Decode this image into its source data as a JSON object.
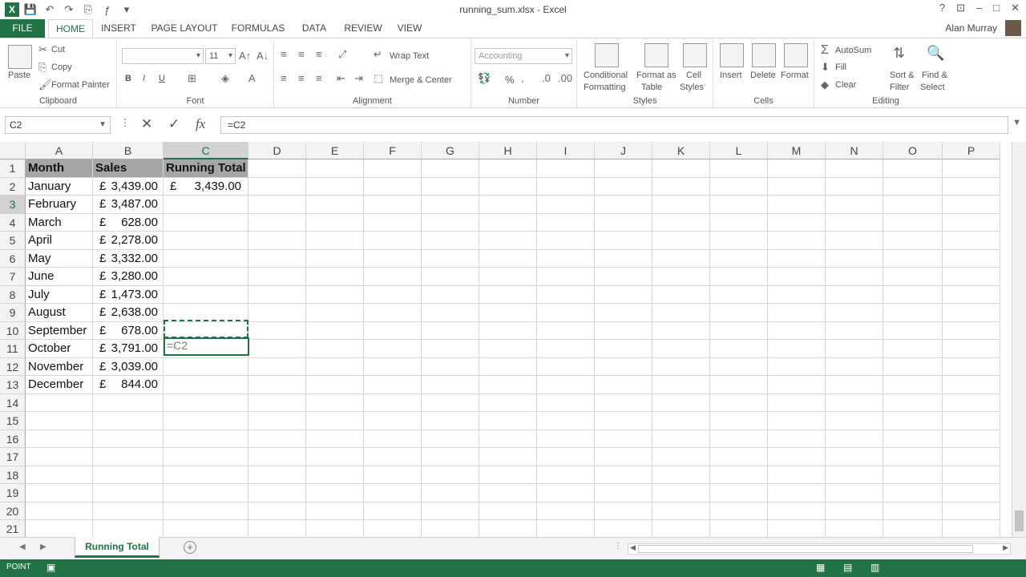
{
  "window": {
    "title": "running_sum.xlsx - Excel",
    "controls": [
      "?",
      "⊡",
      "–",
      "□",
      "✕"
    ]
  },
  "tabs": [
    {
      "label": "FILE"
    },
    {
      "label": "HOME"
    },
    {
      "label": "INSERT"
    },
    {
      "label": "PAGE LAYOUT"
    },
    {
      "label": "FORMULAS"
    },
    {
      "label": "DATA"
    },
    {
      "label": "REVIEW"
    },
    {
      "label": "VIEW"
    }
  ],
  "user": "Alan Murray",
  "ribbon": {
    "clipboard": {
      "label": "Clipboard",
      "paste": "Paste",
      "cut": "Cut",
      "copy": "Copy",
      "format_painter": "Format Painter"
    },
    "font": {
      "label": "Font",
      "size": "11",
      "bold": "B",
      "italic": "I",
      "underline": "U"
    },
    "alignment": {
      "label": "Alignment",
      "wrap": "Wrap Text",
      "merge": "Merge & Center"
    },
    "number": {
      "label": "Number",
      "format": "Accounting",
      "percent": "%"
    },
    "styles": {
      "label": "Styles",
      "conditional": "Conditional",
      "conditional2": "Formatting",
      "format_as": "Format as",
      "format_as2": "Table",
      "cell": "Cell",
      "cell2": "Styles"
    },
    "cells": {
      "label": "Cells",
      "insert": "Insert",
      "delete": "Delete",
      "format": "Format"
    },
    "editing": {
      "label": "Editing",
      "autosum": "AutoSum",
      "fill": "Fill",
      "clear": "Clear",
      "sort": "Sort &",
      "sort2": "Filter",
      "find": "Find &",
      "find2": "Select"
    }
  },
  "formula_bar": {
    "name_box": "C2",
    "formula": "=C2"
  },
  "columns": [
    "A",
    "B",
    "C",
    "D",
    "E",
    "F",
    "G",
    "H",
    "I",
    "J",
    "K",
    "L",
    "M",
    "N",
    "O",
    "P"
  ],
  "rows": [
    "1",
    "2",
    "3",
    "4",
    "5",
    "6",
    "7",
    "8",
    "9",
    "10",
    "11",
    "12",
    "13",
    "14",
    "15",
    "16",
    "17",
    "18",
    "19",
    "20",
    "21"
  ],
  "headers": {
    "month": "Month",
    "sales": "Sales",
    "running_total": "Running Total"
  },
  "data": [
    {
      "month": "January",
      "cur": "£",
      "amount": "3,439.00"
    },
    {
      "month": "February",
      "cur": "£",
      "amount": "3,487.00"
    },
    {
      "month": "March",
      "cur": "£",
      "amount": "628.00"
    },
    {
      "month": "April",
      "cur": "£",
      "amount": "2,278.00"
    },
    {
      "month": "May",
      "cur": "£",
      "amount": "3,332.00"
    },
    {
      "month": "June",
      "cur": "£",
      "amount": "3,280.00"
    },
    {
      "month": "July",
      "cur": "£",
      "amount": "1,473.00"
    },
    {
      "month": "August",
      "cur": "£",
      "amount": "2,638.00"
    },
    {
      "month": "September",
      "cur": "£",
      "amount": "678.00"
    },
    {
      "month": "October",
      "cur": "£",
      "amount": "3,791.00"
    },
    {
      "month": "November",
      "cur": "£",
      "amount": "3,039.00"
    },
    {
      "month": "December",
      "cur": "£",
      "amount": "844.00"
    }
  ],
  "running_total": {
    "c2_cur": "£",
    "c2_amount": "3,439.00",
    "c3_edit": "=C2"
  },
  "sheet": {
    "name": "Running Total",
    "add": "+"
  },
  "status": {
    "mode": "POINT"
  },
  "colors": {
    "accent": "#217346",
    "header_fill": "#a6a6a6"
  }
}
